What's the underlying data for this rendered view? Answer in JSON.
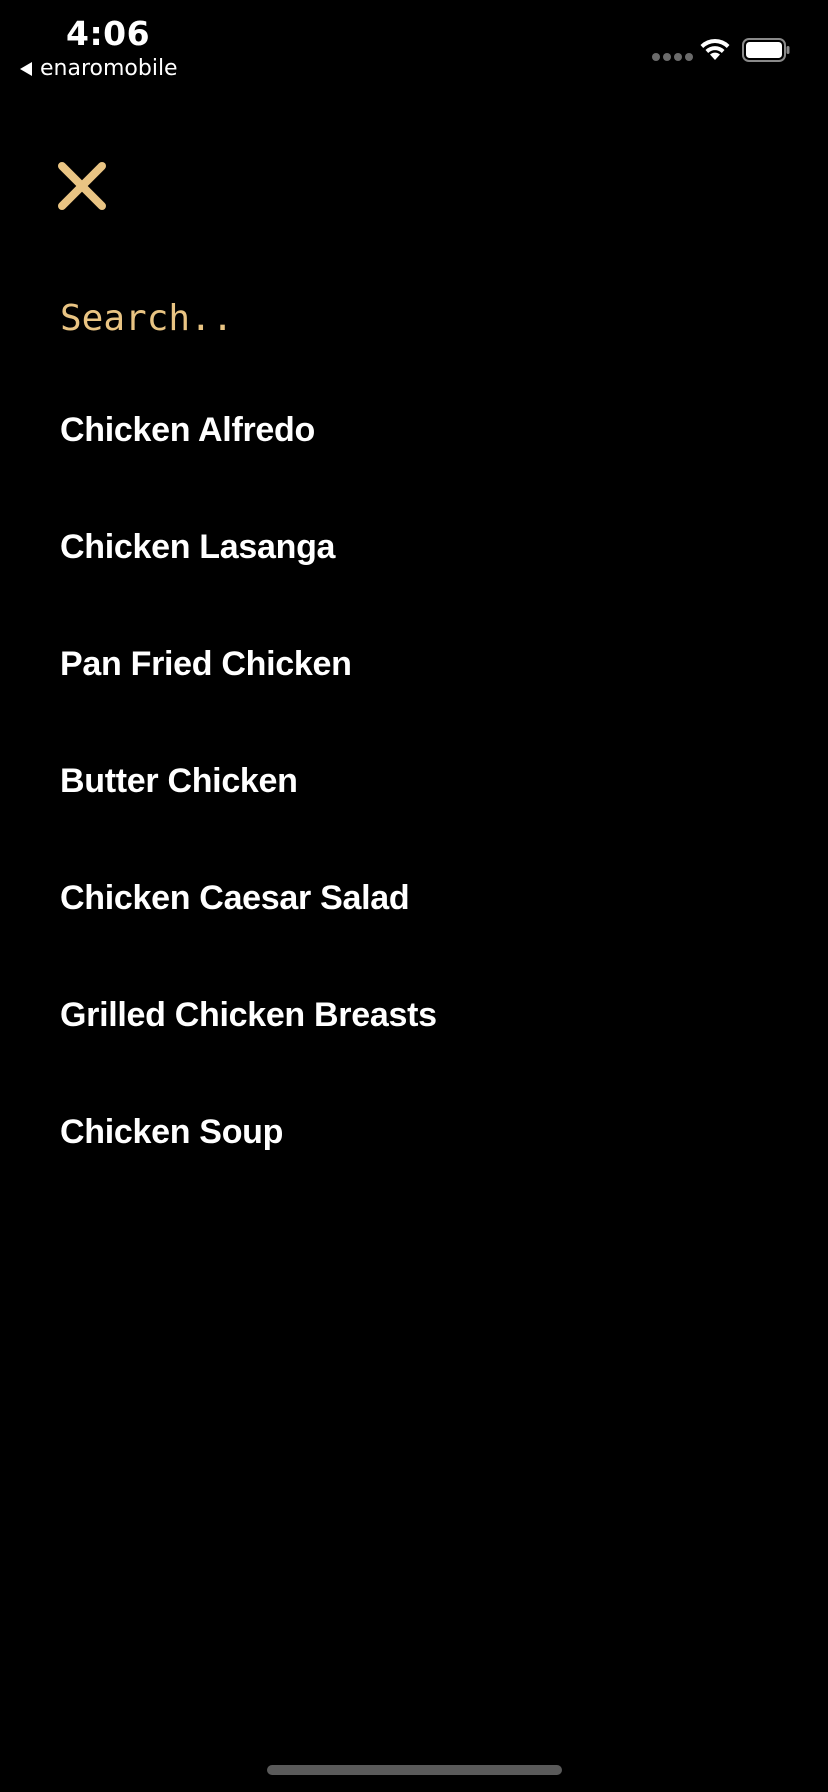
{
  "status_bar": {
    "time": "4:06",
    "back_app_label": "enaromobile",
    "signal_icon": "signal-dots-icon",
    "wifi_icon": "wifi-icon",
    "battery_icon": "battery-icon"
  },
  "close_icon": "close-icon",
  "search": {
    "placeholder": "Search..",
    "value": ""
  },
  "results": [
    {
      "label": "Chicken Alfredo"
    },
    {
      "label": "Chicken Lasanga"
    },
    {
      "label": "Pan Fried Chicken"
    },
    {
      "label": "Butter Chicken"
    },
    {
      "label": "Chicken Caesar Salad"
    },
    {
      "label": "Grilled Chicken Breasts"
    },
    {
      "label": "Chicken Soup"
    }
  ],
  "colors": {
    "background": "#000000",
    "accent": "#e9c483",
    "text": "#ffffff"
  }
}
